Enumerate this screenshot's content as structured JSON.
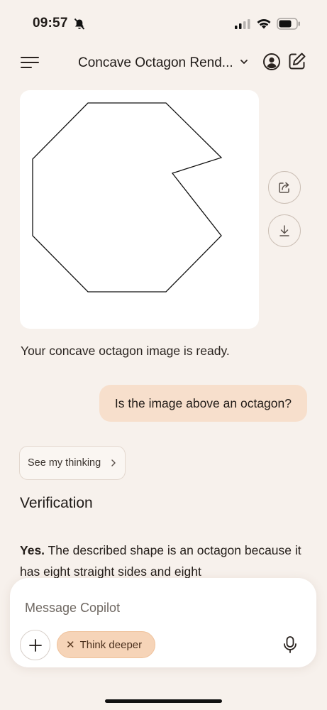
{
  "status": {
    "time": "09:57"
  },
  "header": {
    "title": "Concave Octagon Rend..."
  },
  "image_card": {
    "shape": "concave-octagon-outline"
  },
  "messages": {
    "assistant_intro": "Your concave octagon image is ready.",
    "user_question": "Is the image above an octagon?"
  },
  "thinking": {
    "label": "See my thinking"
  },
  "answer": {
    "heading": "Verification",
    "bold": "Yes.",
    "text": " The described shape is an octagon because it has eight straight sides and eight"
  },
  "composer": {
    "placeholder": "Message Copilot",
    "think_label": "Think deeper"
  },
  "colors": {
    "background": "#f7f1ec",
    "user_bubble": "#f7dfcc",
    "think_chip": "#f6d4b8"
  }
}
